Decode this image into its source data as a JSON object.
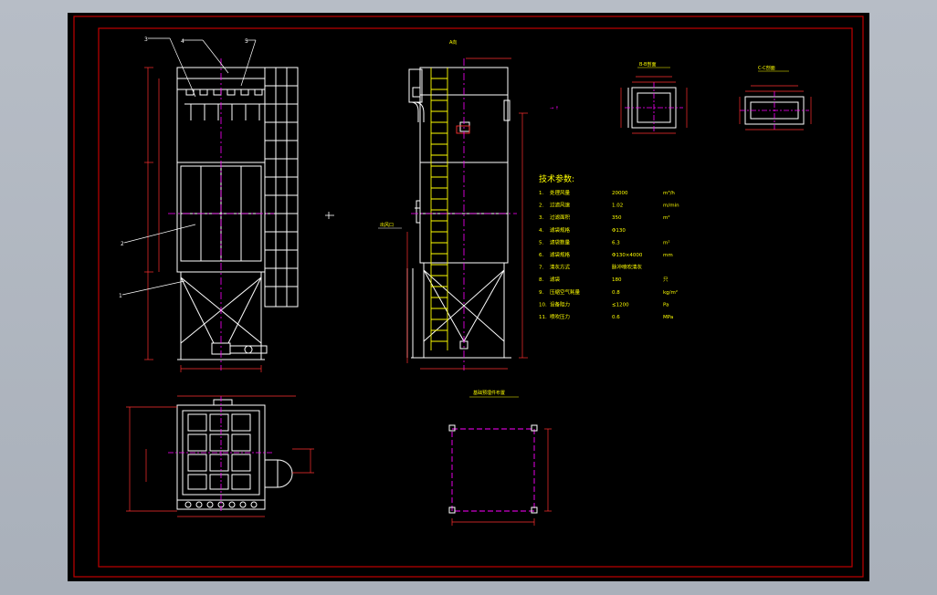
{
  "drawing": {
    "colors": {
      "frame": "#c00000",
      "outline": "#ffffff",
      "centerline": "#ff00ff",
      "ladder": "#ffff00",
      "dim": "#ff3030",
      "text": "#ffff00",
      "background": "#000000",
      "app_background": "#b0b7c0"
    },
    "part_labels": [
      "3",
      "4",
      "5",
      "2",
      "1"
    ],
    "views": {
      "side_view_title": "A向",
      "section_1_title": "B-B剖面",
      "section_2_title": "C-C剖面",
      "foundation_title": "基础预埋件布置",
      "elevation_callout": "出风口"
    },
    "tech_params": {
      "heading": "技术参数:",
      "rows": [
        {
          "no": "1.",
          "name": "处理风量",
          "value": "20000",
          "unit": "m³/h"
        },
        {
          "no": "2.",
          "name": "过滤风速",
          "value": "1.02",
          "unit": "m/min"
        },
        {
          "no": "3.",
          "name": "过滤面积",
          "value": "350",
          "unit": "m²"
        },
        {
          "no": "4.",
          "name": "滤袋规格",
          "value": "Φ130",
          "unit": ""
        },
        {
          "no": "5.",
          "name": "滤袋数量",
          "value": "6.3",
          "unit": "m²"
        },
        {
          "no": "6.",
          "name": "滤袋规格",
          "value": "Φ130×4000",
          "unit": "mm"
        },
        {
          "no": "7.",
          "name": "清灰方式",
          "value": "脉冲喷吹清灰",
          "unit": ""
        },
        {
          "no": "8.",
          "name": "滤袋",
          "value": "180",
          "unit": "只"
        },
        {
          "no": "9.",
          "name": "压缩空气耗量",
          "value": "0.8",
          "unit": "kg/m²"
        },
        {
          "no": "10.",
          "name": "设备阻力",
          "value": "≤1200",
          "unit": "Pa"
        },
        {
          "no": "11.",
          "name": "喷吹压力",
          "value": "0.6",
          "unit": "MPa"
        }
      ]
    }
  }
}
